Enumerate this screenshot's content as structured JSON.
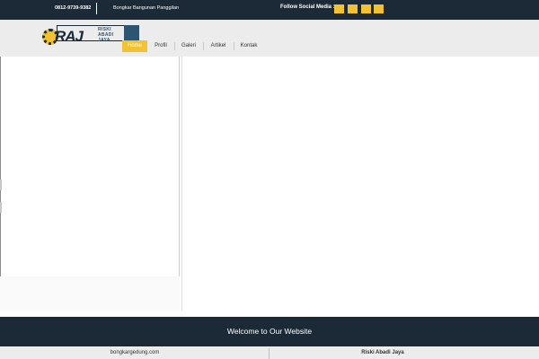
{
  "topbar": {
    "phone": "0812-9739-9382",
    "tagline": "Bongkar Bangunan Panggilan",
    "follow_label": "Follow Social Media :",
    "social_icons": [
      "social-icon-1",
      "social-icon-2",
      "social-icon-3",
      "social-icon-4"
    ]
  },
  "logo": {
    "mark": "RAJ",
    "line1": "RISKI",
    "line2": "ABADI",
    "line3": "JAYA"
  },
  "nav": {
    "items": [
      {
        "label": "Home",
        "active": true
      },
      {
        "label": "Profil",
        "active": false
      },
      {
        "label": "Galeri",
        "active": false
      },
      {
        "label": "Artikel",
        "active": false
      },
      {
        "label": "Kontak",
        "active": false
      }
    ]
  },
  "welcome": {
    "text": "Welcome to Our Website"
  },
  "footer": {
    "site": "bongkargedung.com",
    "company": "Riski Abadi Jaya"
  },
  "colors": {
    "dark": "#1b2a36",
    "accent": "#f3c233",
    "brand_blue": "#2d5470",
    "header_bg": "#ececec"
  }
}
